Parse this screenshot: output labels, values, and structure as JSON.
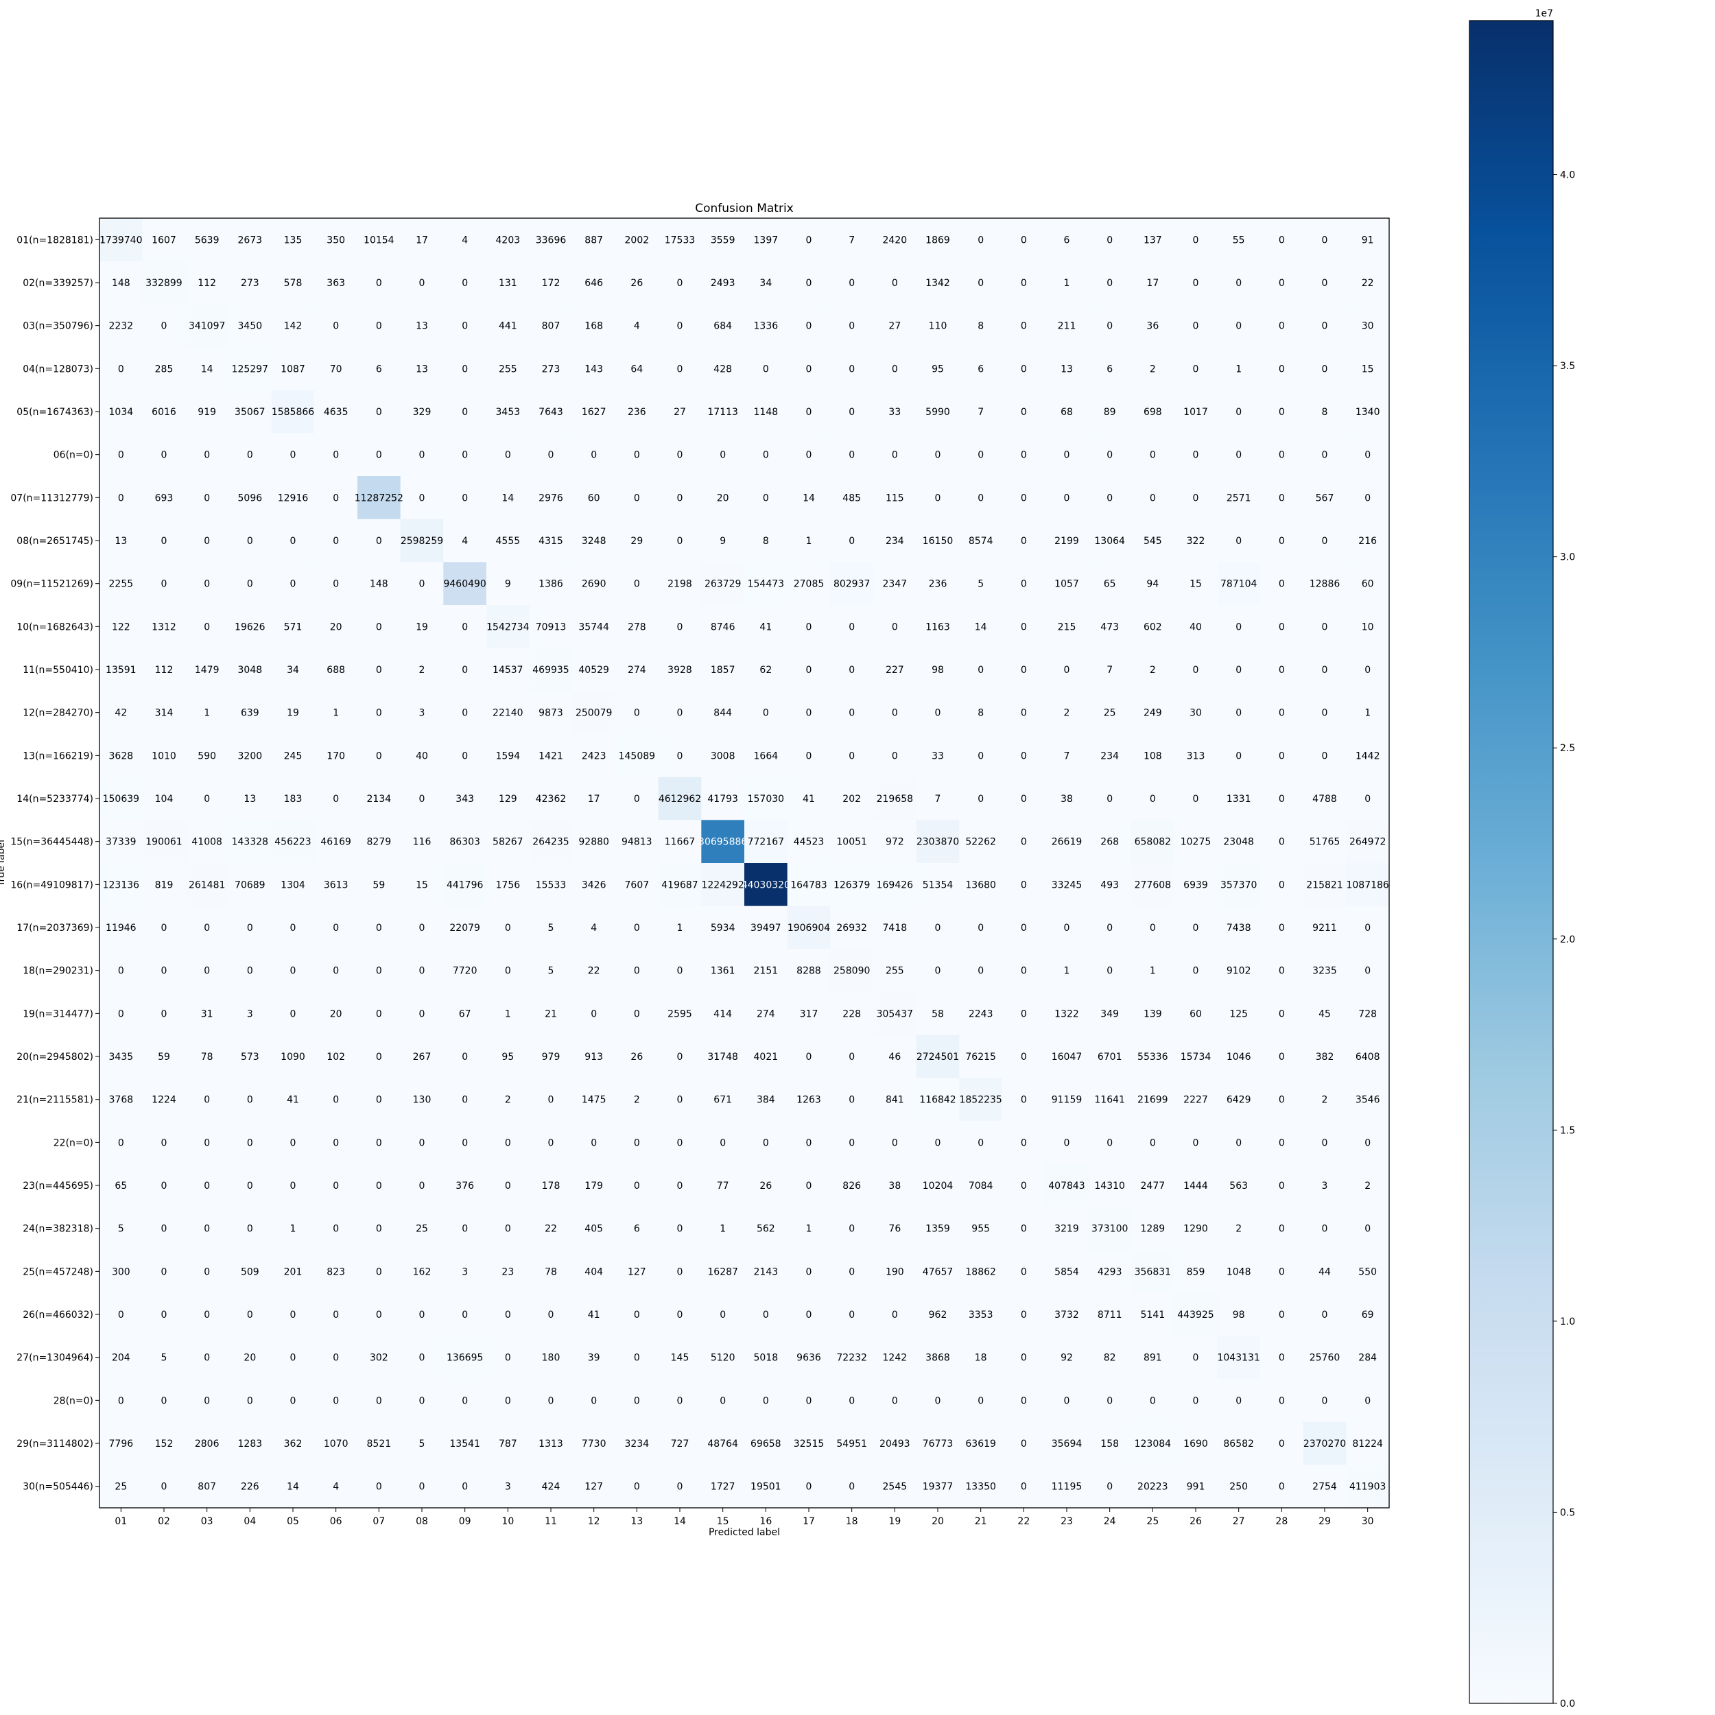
{
  "chart_data": {
    "type": "heatmap",
    "title": "Confusion Matrix",
    "xlabel": "Predicted label",
    "ylabel": "True label",
    "colormap": "Blues",
    "colors": {
      "min": "#f7fbff",
      "max": "#08306b",
      "text_light": "#ffffff",
      "text_dark": "#000000"
    },
    "x_categories": [
      "01",
      "02",
      "03",
      "04",
      "05",
      "06",
      "07",
      "08",
      "09",
      "10",
      "11",
      "12",
      "13",
      "14",
      "15",
      "16",
      "17",
      "18",
      "19",
      "20",
      "21",
      "22",
      "23",
      "24",
      "25",
      "26",
      "27",
      "28",
      "29",
      "30"
    ],
    "y_categories": [
      "01(n=1828181)",
      "02(n=339257)",
      "03(n=350796)",
      "04(n=128073)",
      "05(n=1674363)",
      "06(n=0)",
      "07(n=11312779)",
      "08(n=2651745)",
      "09(n=11521269)",
      "10(n=1682643)",
      "11(n=550410)",
      "12(n=284270)",
      "13(n=166219)",
      "14(n=5233774)",
      "15(n=36445448)",
      "16(n=49109817)",
      "17(n=2037369)",
      "18(n=290231)",
      "19(n=314477)",
      "20(n=2945802)",
      "21(n=2115581)",
      "22(n=0)",
      "23(n=445695)",
      "24(n=382318)",
      "25(n=457248)",
      "26(n=466032)",
      "27(n=1304964)",
      "28(n=0)",
      "29(n=3114802)",
      "30(n=505446)"
    ],
    "values": [
      [
        1739740,
        1607,
        5639,
        2673,
        135,
        350,
        10154,
        17,
        4,
        4203,
        33696,
        887,
        2002,
        17533,
        3559,
        1397,
        0,
        7,
        2420,
        1869,
        0,
        0,
        6,
        0,
        137,
        0,
        55,
        0,
        0,
        91
      ],
      [
        148,
        332899,
        112,
        273,
        578,
        363,
        0,
        0,
        0,
        131,
        172,
        646,
        26,
        0,
        2493,
        34,
        0,
        0,
        0,
        1342,
        0,
        0,
        1,
        0,
        17,
        0,
        0,
        0,
        0,
        22
      ],
      [
        2232,
        0,
        341097,
        3450,
        142,
        0,
        0,
        13,
        0,
        441,
        807,
        168,
        4,
        0,
        684,
        1336,
        0,
        0,
        27,
        110,
        8,
        0,
        211,
        0,
        36,
        0,
        0,
        0,
        0,
        30
      ],
      [
        0,
        285,
        14,
        125297,
        1087,
        70,
        6,
        13,
        0,
        255,
        273,
        143,
        64,
        0,
        428,
        0,
        0,
        0,
        0,
        95,
        6,
        0,
        13,
        6,
        2,
        0,
        1,
        0,
        0,
        15
      ],
      [
        1034,
        6016,
        919,
        35067,
        1585866,
        4635,
        0,
        329,
        0,
        3453,
        7643,
        1627,
        236,
        27,
        17113,
        1148,
        0,
        0,
        33,
        5990,
        7,
        0,
        68,
        89,
        698,
        1017,
        0,
        0,
        8,
        1340
      ],
      [
        0,
        0,
        0,
        0,
        0,
        0,
        0,
        0,
        0,
        0,
        0,
        0,
        0,
        0,
        0,
        0,
        0,
        0,
        0,
        0,
        0,
        0,
        0,
        0,
        0,
        0,
        0,
        0,
        0,
        0
      ],
      [
        0,
        693,
        0,
        5096,
        12916,
        0,
        11287252,
        0,
        0,
        14,
        2976,
        60,
        0,
        0,
        20,
        0,
        14,
        485,
        115,
        0,
        0,
        0,
        0,
        0,
        0,
        0,
        2571,
        0,
        567,
        0
      ],
      [
        13,
        0,
        0,
        0,
        0,
        0,
        0,
        2598259,
        4,
        4555,
        4315,
        3248,
        29,
        0,
        9,
        8,
        1,
        0,
        234,
        16150,
        8574,
        0,
        2199,
        13064,
        545,
        322,
        0,
        0,
        0,
        216
      ],
      [
        2255,
        0,
        0,
        0,
        0,
        0,
        148,
        0,
        9460490,
        9,
        1386,
        2690,
        0,
        2198,
        263729,
        154473,
        27085,
        802937,
        2347,
        236,
        5,
        0,
        1057,
        65,
        94,
        15,
        787104,
        0,
        12886,
        60
      ],
      [
        122,
        1312,
        0,
        19626,
        571,
        20,
        0,
        19,
        0,
        1542734,
        70913,
        35744,
        278,
        0,
        8746,
        41,
        0,
        0,
        0,
        1163,
        14,
        0,
        215,
        473,
        602,
        40,
        0,
        0,
        0,
        10
      ],
      [
        13591,
        112,
        1479,
        3048,
        34,
        688,
        0,
        2,
        0,
        14537,
        469935,
        40529,
        274,
        3928,
        1857,
        62,
        0,
        0,
        227,
        98,
        0,
        0,
        0,
        7,
        2,
        0,
        0,
        0,
        0,
        0
      ],
      [
        42,
        314,
        1,
        639,
        19,
        1,
        0,
        3,
        0,
        22140,
        9873,
        250079,
        0,
        0,
        844,
        0,
        0,
        0,
        0,
        0,
        8,
        0,
        2,
        25,
        249,
        30,
        0,
        0,
        0,
        1
      ],
      [
        3628,
        1010,
        590,
        3200,
        245,
        170,
        0,
        40,
        0,
        1594,
        1421,
        2423,
        145089,
        0,
        3008,
        1664,
        0,
        0,
        0,
        33,
        0,
        0,
        7,
        234,
        108,
        313,
        0,
        0,
        0,
        1442
      ],
      [
        150639,
        104,
        0,
        13,
        183,
        0,
        2134,
        0,
        343,
        129,
        42362,
        17,
        0,
        4612962,
        41793,
        157030,
        41,
        202,
        219658,
        7,
        0,
        0,
        38,
        0,
        0,
        0,
        1331,
        0,
        4788,
        0
      ],
      [
        37339,
        190061,
        41008,
        143328,
        456223,
        46169,
        8279,
        116,
        86303,
        58267,
        264235,
        92880,
        94813,
        11667,
        30695886,
        772167,
        44523,
        10051,
        972,
        2303870,
        52262,
        0,
        26619,
        268,
        658082,
        10275,
        23048,
        0,
        51765,
        264972
      ],
      [
        123136,
        819,
        261481,
        70689,
        1304,
        3613,
        59,
        15,
        441796,
        1756,
        15533,
        3426,
        7607,
        419687,
        1224292,
        44030320,
        164783,
        126379,
        169426,
        51354,
        13680,
        0,
        33245,
        493,
        277608,
        6939,
        357370,
        0,
        215821,
        1087186
      ],
      [
        11946,
        0,
        0,
        0,
        0,
        0,
        0,
        0,
        22079,
        0,
        5,
        4,
        0,
        1,
        5934,
        39497,
        1906904,
        26932,
        7418,
        0,
        0,
        0,
        0,
        0,
        0,
        0,
        7438,
        0,
        9211,
        0
      ],
      [
        0,
        0,
        0,
        0,
        0,
        0,
        0,
        0,
        7720,
        0,
        5,
        22,
        0,
        0,
        1361,
        2151,
        8288,
        258090,
        255,
        0,
        0,
        0,
        1,
        0,
        1,
        0,
        9102,
        0,
        3235,
        0
      ],
      [
        0,
        0,
        31,
        3,
        0,
        20,
        0,
        0,
        67,
        1,
        21,
        0,
        0,
        2595,
        414,
        274,
        317,
        228,
        305437,
        58,
        2243,
        0,
        1322,
        349,
        139,
        60,
        125,
        0,
        45,
        728
      ],
      [
        3435,
        59,
        78,
        573,
        1090,
        102,
        0,
        267,
        0,
        95,
        979,
        913,
        26,
        0,
        31748,
        4021,
        0,
        0,
        46,
        2724501,
        76215,
        0,
        16047,
        6701,
        55336,
        15734,
        1046,
        0,
        382,
        6408
      ],
      [
        3768,
        1224,
        0,
        0,
        41,
        0,
        0,
        130,
        0,
        2,
        0,
        1475,
        2,
        0,
        671,
        384,
        1263,
        0,
        841,
        116842,
        1852235,
        0,
        91159,
        11641,
        21699,
        2227,
        6429,
        0,
        2,
        3546
      ],
      [
        0,
        0,
        0,
        0,
        0,
        0,
        0,
        0,
        0,
        0,
        0,
        0,
        0,
        0,
        0,
        0,
        0,
        0,
        0,
        0,
        0,
        0,
        0,
        0,
        0,
        0,
        0,
        0,
        0,
        0
      ],
      [
        65,
        0,
        0,
        0,
        0,
        0,
        0,
        0,
        376,
        0,
        178,
        179,
        0,
        0,
        77,
        26,
        0,
        826,
        38,
        10204,
        7084,
        0,
        407843,
        14310,
        2477,
        1444,
        563,
        0,
        3,
        2
      ],
      [
        5,
        0,
        0,
        0,
        1,
        0,
        0,
        25,
        0,
        0,
        22,
        405,
        6,
        0,
        1,
        562,
        1,
        0,
        76,
        1359,
        955,
        0,
        3219,
        373100,
        1289,
        1290,
        2,
        0,
        0,
        0
      ],
      [
        300,
        0,
        0,
        509,
        201,
        823,
        0,
        162,
        3,
        23,
        78,
        404,
        127,
        0,
        16287,
        2143,
        0,
        0,
        190,
        47657,
        18862,
        0,
        5854,
        4293,
        356831,
        859,
        1048,
        0,
        44,
        550
      ],
      [
        0,
        0,
        0,
        0,
        0,
        0,
        0,
        0,
        0,
        0,
        0,
        41,
        0,
        0,
        0,
        0,
        0,
        0,
        0,
        962,
        3353,
        0,
        3732,
        8711,
        5141,
        443925,
        98,
        0,
        0,
        69
      ],
      [
        204,
        5,
        0,
        20,
        0,
        0,
        302,
        0,
        136695,
        0,
        180,
        39,
        0,
        145,
        5120,
        5018,
        9636,
        72232,
        1242,
        3868,
        18,
        0,
        92,
        82,
        891,
        0,
        1043131,
        0,
        25760,
        284
      ],
      [
        0,
        0,
        0,
        0,
        0,
        0,
        0,
        0,
        0,
        0,
        0,
        0,
        0,
        0,
        0,
        0,
        0,
        0,
        0,
        0,
        0,
        0,
        0,
        0,
        0,
        0,
        0,
        0,
        0,
        0
      ],
      [
        7796,
        152,
        2806,
        1283,
        362,
        1070,
        8521,
        5,
        13541,
        787,
        1313,
        7730,
        3234,
        727,
        48764,
        69658,
        32515,
        54951,
        20493,
        76773,
        63619,
        0,
        35694,
        158,
        123084,
        1690,
        86582,
        0,
        2370270,
        81224
      ],
      [
        25,
        0,
        807,
        226,
        14,
        4,
        0,
        0,
        0,
        3,
        424,
        127,
        0,
        0,
        1727,
        19501,
        0,
        0,
        2545,
        19377,
        13350,
        0,
        11195,
        0,
        20223,
        991,
        250,
        0,
        2754,
        411903
      ]
    ],
    "colorbar": {
      "range": [
        0,
        44030320
      ],
      "ticks": [
        0,
        5000000,
        10000000,
        15000000,
        20000000,
        25000000,
        30000000,
        35000000,
        40000000
      ],
      "tick_labels": [
        "0.0",
        "0.5",
        "1.0",
        "1.5",
        "2.0",
        "2.5",
        "3.0",
        "3.5",
        "4.0"
      ],
      "offset_label": "1e7"
    }
  }
}
